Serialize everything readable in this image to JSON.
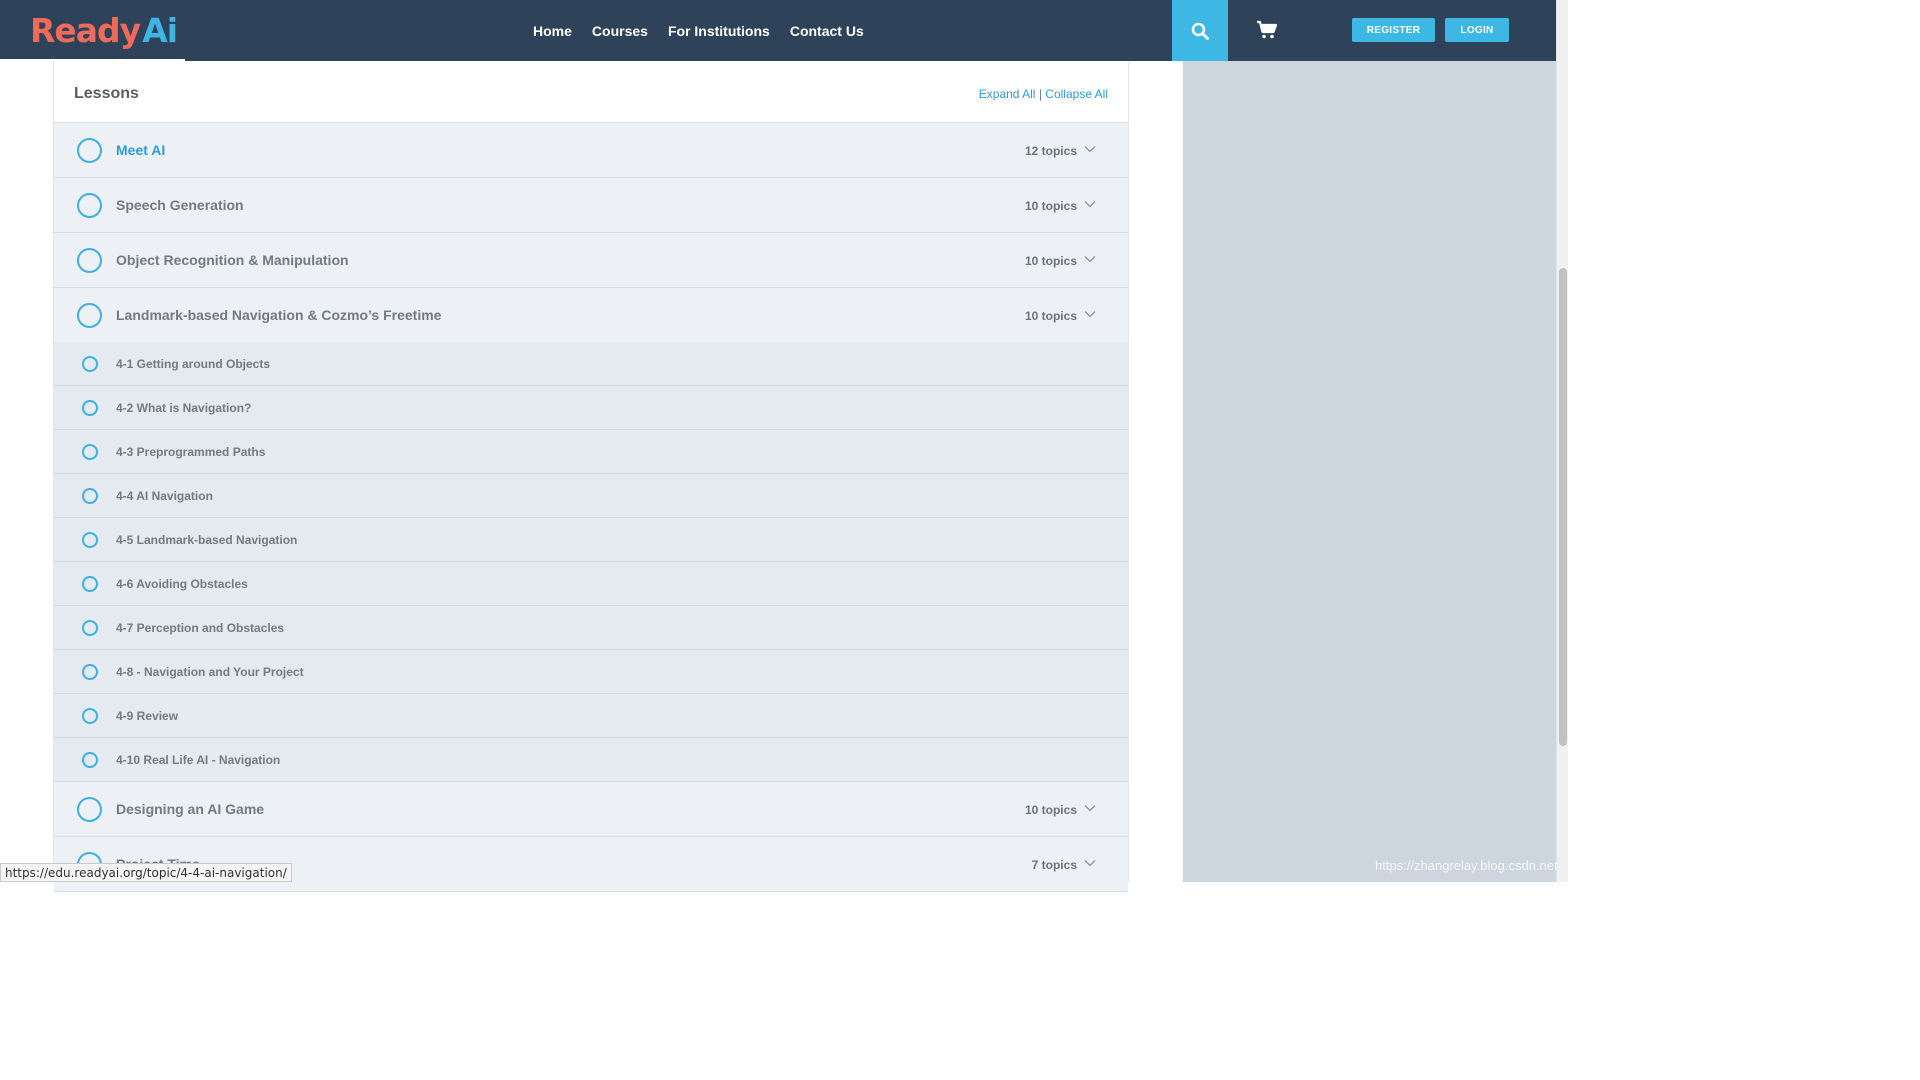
{
  "header": {
    "logo_ready": "Ready",
    "logo_ai": "Ai",
    "nav": [
      "Home",
      "Courses",
      "For Institutions",
      "Contact Us"
    ],
    "register_label": "REGISTER",
    "login_label": "LOGIN",
    "search_icon": "search-icon",
    "cart_icon": "cart-icon"
  },
  "lessons_panel": {
    "title": "Lessons",
    "expand_all": "Expand All",
    "separator": "|",
    "collapse_all": "Collapse All",
    "lessons": [
      {
        "title": "Meet AI",
        "count": "12 topics",
        "active": true
      },
      {
        "title": "Speech Generation",
        "count": "10 topics"
      },
      {
        "title": "Object Recognition & Manipulation",
        "count": "10 topics"
      },
      {
        "title": "Landmark-based Navigation & Cozmo’s Freetime",
        "count": "10 topics",
        "expanded": true
      },
      {
        "title": "Designing an AI Game",
        "count": "10 topics"
      },
      {
        "title": "Project Time",
        "count": "7 topics"
      }
    ],
    "topics": [
      "4-1 Getting around Objects",
      "4-2 What is Navigation?",
      "4-3 Preprogrammed Paths",
      "4-4 AI Navigation",
      "4-5 Landmark-based Navigation",
      "4-6 Avoiding Obstacles",
      "4-7 Perception and Obstacles",
      "4-8 - Navigation and Your Project",
      "4-9 Review",
      "4-10 Real Life AI - Navigation"
    ]
  },
  "status_url": "https://edu.readyai.org/topic/4-4-ai-navigation/",
  "watermark": "https://zhangrelay.blog.csdn.net",
  "colors": {
    "header_bg": "#2e4259",
    "accent": "#3db8e4",
    "link": "#2f9bd9",
    "logo_red": "#ef6a5b",
    "sidebar_bg": "#cdd5de"
  }
}
